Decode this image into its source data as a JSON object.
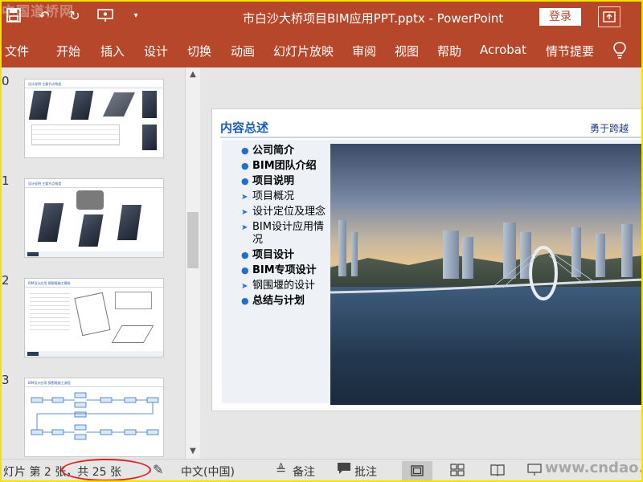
{
  "titlebar": {
    "doc_title": "市白沙大桥项目BIM应用PPT.pptx - PowerPoint",
    "login_label": "登录",
    "watermark": "中国道桥网",
    "qat_icons": [
      "save-icon",
      "undo-icon",
      "redo-icon",
      "present-icon",
      "customize-icon"
    ],
    "accent_color": "#b7472a"
  },
  "ribbon": {
    "tabs": [
      "文件",
      "开始",
      "插入",
      "设计",
      "切换",
      "动画",
      "幻灯片放映",
      "审阅",
      "视图",
      "帮助",
      "Acrobat",
      "情节提要"
    ],
    "tell_me_icon": "lightbulb-icon"
  },
  "thumbnails": {
    "numbers": [
      "0",
      "1",
      "2",
      "3"
    ],
    "titles": [
      "设计说明  主要节点构造",
      "设计说明  主要节点构造",
      "BIM设计应用  钢围堰施工模拟",
      "BIM设计应用  钢围堰施工流程"
    ]
  },
  "slide": {
    "title": "内容总述",
    "slogan": "勇于跨越",
    "bullets": [
      {
        "text": "公司简介",
        "style": "dot"
      },
      {
        "text": "BIM团队介绍",
        "style": "dot"
      },
      {
        "text": "项目说明",
        "style": "dot"
      },
      {
        "text": "项目概况",
        "style": "arrow"
      },
      {
        "text": "设计定位及理念",
        "style": "arrow"
      },
      {
        "text": "BIM设计应用情况",
        "style": "arrow"
      },
      {
        "text": "项目设计",
        "style": "dot"
      },
      {
        "text": "BIM专项设计",
        "style": "dot"
      },
      {
        "text": "钢围堰的设计",
        "style": "arrow"
      },
      {
        "text": "总结与计划",
        "style": "dot"
      }
    ]
  },
  "statusbar": {
    "slide_info": "灯片 第 2 张，共 25 张",
    "language": "中文(中国)",
    "notes_label": "备注",
    "comments_label": "批注",
    "watermark": "www.cndao.com"
  }
}
